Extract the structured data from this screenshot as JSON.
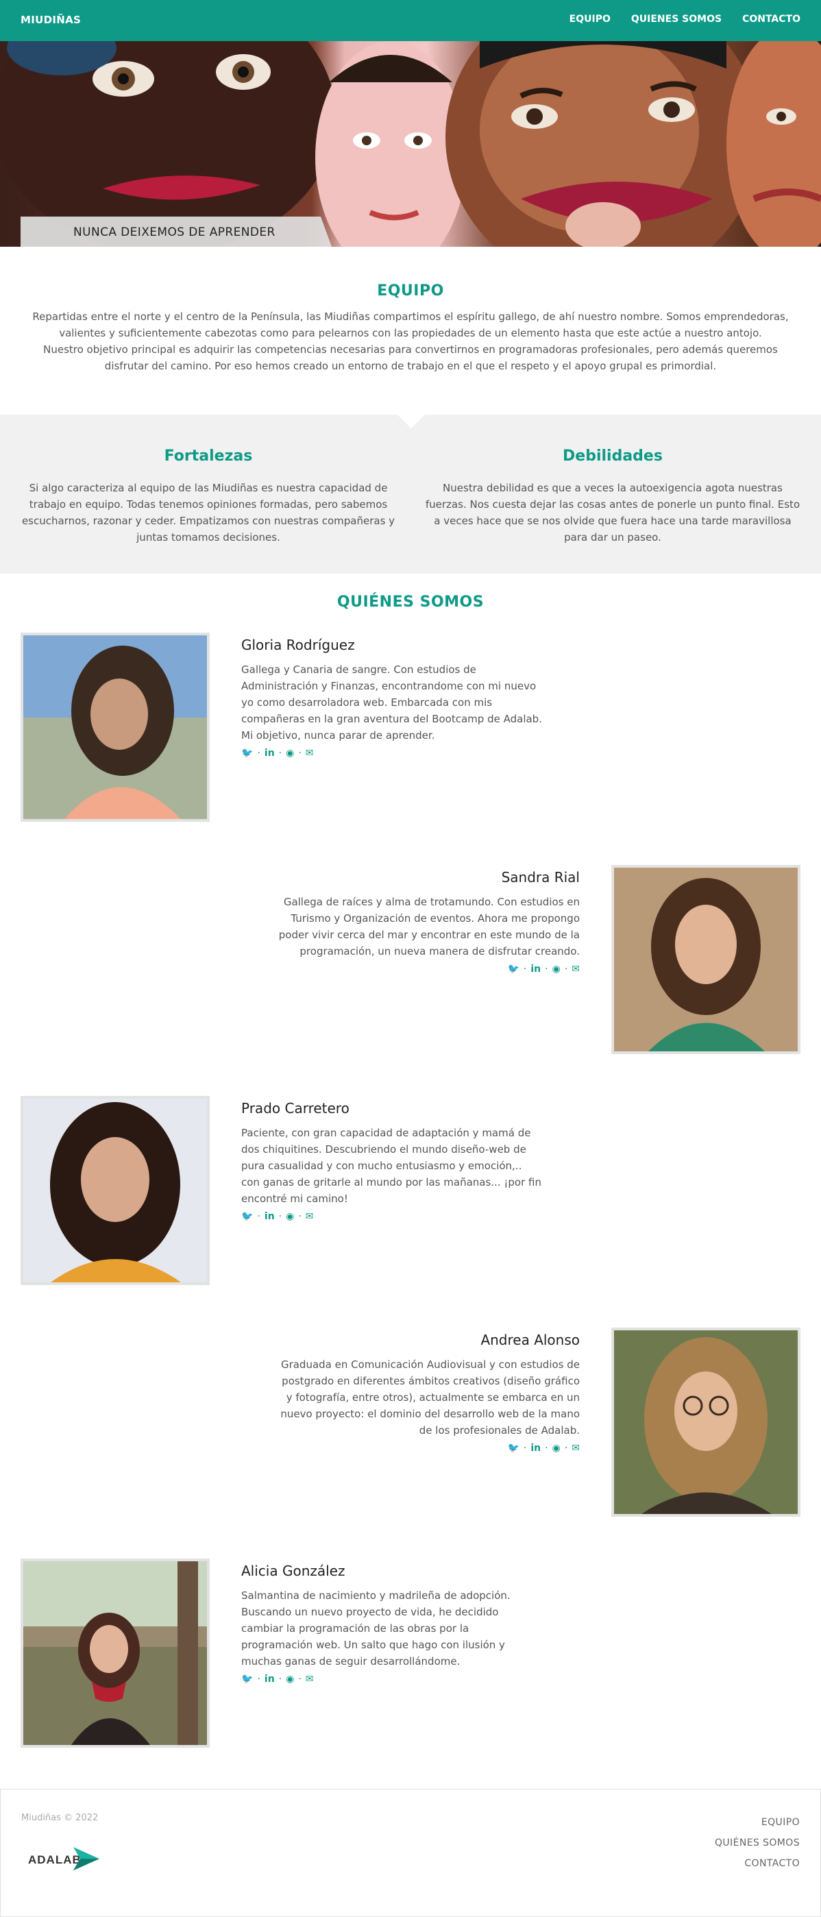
{
  "header": {
    "brand": "MIUDIÑAS",
    "nav": [
      "EQUIPO",
      "QUIENES SOMOS",
      "CONTACTO"
    ]
  },
  "hero": {
    "caption": "NUNCA DEIXEMOS DE APRENDER"
  },
  "team": {
    "title": "EQUIPO",
    "paragraph1": "Repartidas entre el norte y el centro de la Península, las Miudiñas compartimos el espíritu gallego, de ahí nuestro nombre. Somos emprendedoras, valientes y suficientemente cabezotas como para pelearnos con las propiedades de un elemento hasta que este actúe a nuestro antojo.",
    "paragraph2": "Nuestro objetivo principal es adquirir las competencias necesarias para convertirnos en programadoras profesionales, pero además queremos disfrutar del camino. Por eso hemos creado un entorno de trabajo en el que el respeto y el apoyo grupal es primordial."
  },
  "traits": {
    "strengths": {
      "title": "Fortalezas",
      "text": "Si algo caracteriza al equipo de las Miudiñas es nuestra capacidad de trabajo en equipo. Todas tenemos opiniones formadas, pero sabemos escucharnos, razonar y ceder. Empatizamos con nuestras compañeras y juntas tomamos decisiones."
    },
    "weaknesses": {
      "title": "Debilidades",
      "text": "Nuestra debilidad es que a veces la autoexigencia agota nuestras fuerzas. Nos cuesta dejar las cosas antes de ponerle un punto final. Esto a veces hace que se nos olvide que fuera hace una tarde maravillosa para dar un paseo."
    }
  },
  "about": {
    "title": "QUIÉNES SOMOS",
    "members": [
      {
        "name": "Gloria Rodríguez",
        "bio": "Gallega y Canaria de sangre. Con estudios de Administración y Finanzas, encontrandome con mi nuevo yo como desarroladora web. Embarcada con mis compañeras en la gran aventura del Bootcamp de Adalab. Mi objetivo, nunca parar de aprender."
      },
      {
        "name": "Sandra Rial",
        "bio": "Gallega de raíces y alma de trotamundo. Con estudios en Turismo y Organización de eventos. Ahora me propongo poder vivir cerca del mar y encontrar en este mundo de la programación, un nueva manera de disfrutar creando."
      },
      {
        "name": "Prado Carretero",
        "bio": "Paciente, con gran capacidad de adaptación y mamá de dos chiquitines. Descubriendo el mundo diseño-web de pura casualidad y con mucho entusiasmo y emoción,.. con ganas de gritarle al mundo por las mañanas... ¡por fin encontré mi camino!"
      },
      {
        "name": "Andrea Alonso",
        "bio": "Graduada en Comunicación Audiovisual y con estudios de postgrado en diferentes ámbitos creativos (diseño gráfico y fotografía, entre otros), actualmente se embarca en un nuevo proyecto: el dominio del desarrollo web de la mano de los profesionales de Adalab."
      },
      {
        "name": "Alicia González",
        "bio": "Salmantina de nacimiento y madrileña de adopción. Buscando un nuevo proyecto de vida, he decidido cambiar la programación de las obras por la programación web. Un salto que hago con ilusión y muchas ganas de seguir desarrollándome."
      }
    ],
    "social_icons": [
      "twitter-icon",
      "linkedin-icon",
      "github-icon",
      "email-icon"
    ]
  },
  "footer": {
    "copyright": "Miudiñas © 2022",
    "logo_text": "ADALAB",
    "nav": [
      "EQUIPO",
      "QUIÉNES SOMOS",
      "CONTACTO"
    ]
  },
  "colors": {
    "accent": "#0e9a87",
    "traits_bg": "#f1f1f1"
  }
}
